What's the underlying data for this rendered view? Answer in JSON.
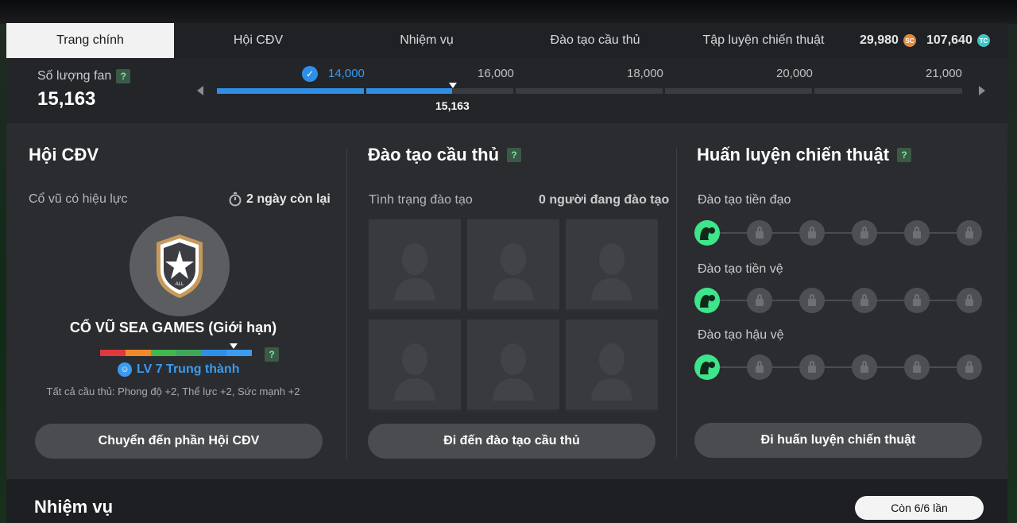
{
  "nav": {
    "tabs": [
      "Trang chính",
      "Hội CĐV",
      "Nhiệm vụ",
      "Đào tạo cầu thủ",
      "Tập luyện chiến thuật"
    ],
    "active_tab": "Trang chính",
    "sc_balance": "29,980",
    "sc_icon_text": "SC",
    "tc_balance": "107,640",
    "tc_icon_text": "TC"
  },
  "fans": {
    "label": "Số lượng fan",
    "help": "?",
    "value": "15,163",
    "milestones": [
      "14,000",
      "16,000",
      "18,000",
      "20,000",
      "21,000"
    ],
    "current_marker": "15,163",
    "progress_fraction": 0.31
  },
  "club": {
    "title": "Hội CĐV",
    "active_label": "Cổ vũ có hiệu lực",
    "time_left": "2 ngày còn lại",
    "badge_text": "ALL",
    "cheer_name": "CỔ VŨ SEA GAMES (Giới hạn)",
    "help": "?",
    "level": "LV 7 Trung thành",
    "bonus": "Tất cả cầu thủ: Phong độ +2, Thể lực +2, Sức mạnh +2",
    "button": "Chuyển đến phần Hội CĐV",
    "level_colors": [
      "#e0383e",
      "#ee8a2c",
      "#3fb84f",
      "#3ea75a",
      "#2f8fe6",
      "#3a9bf0"
    ]
  },
  "training": {
    "title": "Đào tạo cầu thủ",
    "help": "?",
    "status_label": "Tình trạng đào tạo",
    "status_value": "0 người đang đào tạo",
    "button": "Đi đến đào tạo cầu thủ"
  },
  "tactics": {
    "title": "Huấn luyện chiến thuật",
    "help": "?",
    "rows": [
      "Đào tạo tiền đạo",
      "Đào tạo tiền vệ",
      "Đào tạo hậu vệ"
    ],
    "button": "Đi huấn luyện chiến thuật"
  },
  "missions": {
    "title": "Nhiệm vụ",
    "remaining": "Còn 6/6 lần"
  }
}
